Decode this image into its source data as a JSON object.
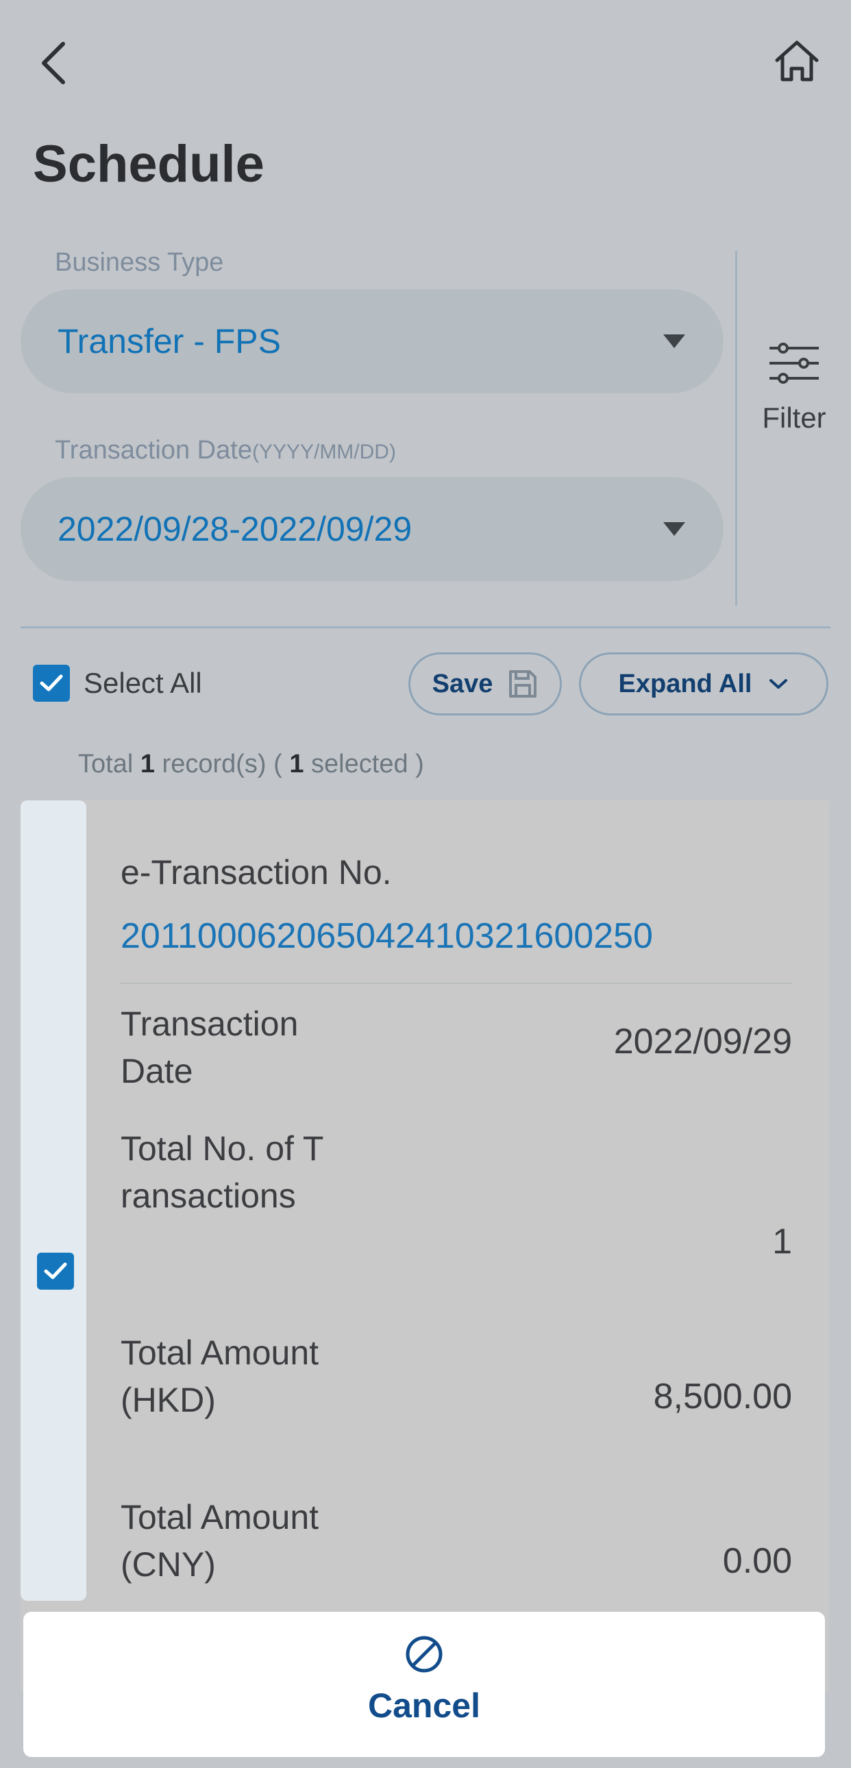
{
  "header": {
    "title": "Schedule",
    "back_icon": "chevron-left-icon",
    "home_icon": "home-icon"
  },
  "filters": {
    "business_type": {
      "label": "Business Type",
      "value": "Transfer - FPS"
    },
    "transaction_date": {
      "label": "Transaction Date",
      "format_hint": "(YYYY/MM/DD)",
      "value": "2022/09/28-2022/09/29"
    },
    "filter_button": {
      "label": "Filter",
      "icon": "sliders-icon"
    }
  },
  "toolbar": {
    "select_all_label": "Select All",
    "select_all_checked": true,
    "save_label": "Save",
    "save_icon": "floppy-disk-icon",
    "expand_all_label": "Expand All",
    "expand_icon": "chevron-down-icon"
  },
  "summary": {
    "prefix": "Total",
    "total_records": "1",
    "records_text": "record(s) (",
    "selected_count": "1",
    "selected_text": "selected )"
  },
  "records": [
    {
      "checked": true,
      "etx_label": "e-Transaction No.",
      "etx_value": "201100062065042410321600250",
      "fields": [
        {
          "label": "Transaction Date",
          "value": "2022/09/29"
        },
        {
          "label": "Total No. of Transactions",
          "value": "1"
        },
        {
          "label": "Total Amount(HKD)",
          "value": "8,500.00"
        },
        {
          "label": "Total Amount(CNY)",
          "value": "0.00"
        }
      ]
    }
  ],
  "bottom_sheet": {
    "cancel_label": "Cancel",
    "cancel_icon": "prohibited-icon"
  },
  "colors": {
    "accent": "#1477bd",
    "value_text": "#1a74b6",
    "background": "#c2c6ca",
    "cancel_text": "#124c8b"
  }
}
